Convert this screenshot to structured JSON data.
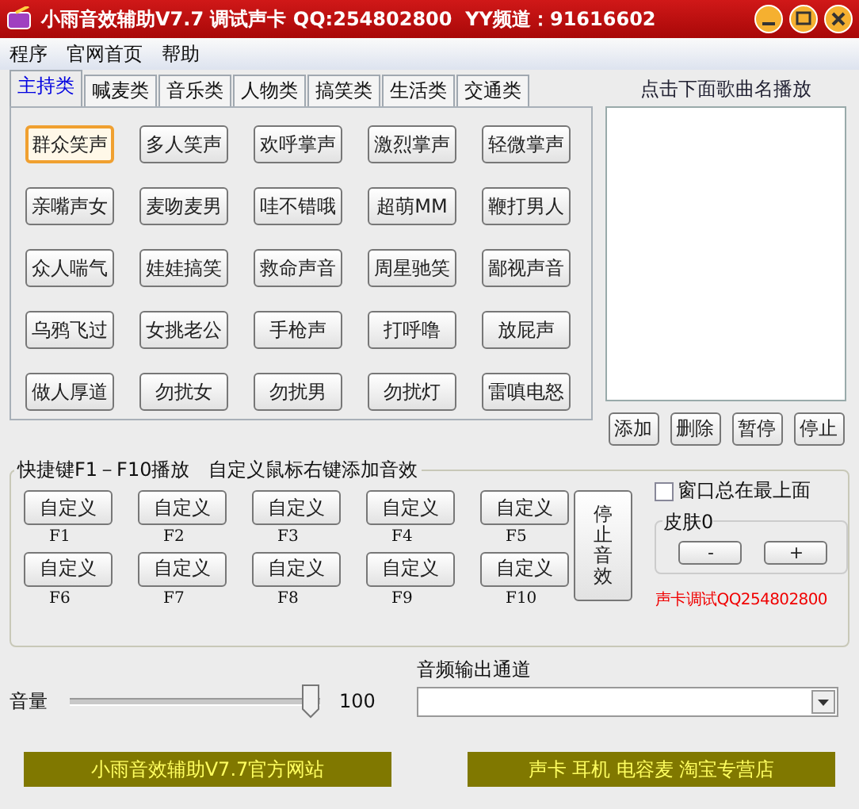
{
  "window": {
    "title": "小雨音效辅助V7.7 调试声卡 QQ:254802800  YY频道：91616602"
  },
  "menu": [
    "程序",
    "官网首页",
    "帮助"
  ],
  "tabs": [
    {
      "label": "主持类",
      "selected": true
    },
    {
      "label": "喊麦类",
      "selected": false
    },
    {
      "label": "音乐类",
      "selected": false
    },
    {
      "label": "人物类",
      "selected": false
    },
    {
      "label": "搞笑类",
      "selected": false
    },
    {
      "label": "生活类",
      "selected": false
    },
    {
      "label": "交通类",
      "selected": false
    }
  ],
  "sound_buttons": [
    {
      "label": "群众笑声",
      "selected": true
    },
    {
      "label": "多人笑声",
      "selected": false
    },
    {
      "label": "欢呼掌声",
      "selected": false
    },
    {
      "label": "激烈掌声",
      "selected": false
    },
    {
      "label": "轻微掌声",
      "selected": false
    },
    {
      "label": "亲嘴声女",
      "selected": false
    },
    {
      "label": "麦吻麦男",
      "selected": false
    },
    {
      "label": "哇不错哦",
      "selected": false
    },
    {
      "label": "超萌MM",
      "selected": false
    },
    {
      "label": "鞭打男人",
      "selected": false
    },
    {
      "label": "众人喘气",
      "selected": false
    },
    {
      "label": "娃娃搞笑",
      "selected": false
    },
    {
      "label": "救命声音",
      "selected": false
    },
    {
      "label": "周星驰笑",
      "selected": false
    },
    {
      "label": "鄙视声音",
      "selected": false
    },
    {
      "label": "乌鸦飞过",
      "selected": false
    },
    {
      "label": "女挑老公",
      "selected": false
    },
    {
      "label": "手枪声",
      "selected": false
    },
    {
      "label": "打呼噜",
      "selected": false
    },
    {
      "label": "放屁声",
      "selected": false
    },
    {
      "label": "做人厚道",
      "selected": false
    },
    {
      "label": "勿扰女",
      "selected": false
    },
    {
      "label": "勿扰男",
      "selected": false
    },
    {
      "label": "勿扰灯",
      "selected": false
    },
    {
      "label": "雷嗔电怒",
      "selected": false
    }
  ],
  "playlist": {
    "label": "点击下面歌曲名播放",
    "buttons": [
      "添加",
      "删除",
      "暂停",
      "停止"
    ]
  },
  "hotkeys": {
    "title": "快捷键F1－F10播放　自定义鼠标右键添加音效",
    "buttons": [
      {
        "label": "自定义",
        "key": "F1"
      },
      {
        "label": "自定义",
        "key": "F2"
      },
      {
        "label": "自定义",
        "key": "F3"
      },
      {
        "label": "自定义",
        "key": "F4"
      },
      {
        "label": "自定义",
        "key": "F5"
      },
      {
        "label": "自定义",
        "key": "F6"
      },
      {
        "label": "自定义",
        "key": "F7"
      },
      {
        "label": "自定义",
        "key": "F8"
      },
      {
        "label": "自定义",
        "key": "F9"
      },
      {
        "label": "自定义",
        "key": "F10"
      }
    ],
    "stop_button": "停止音效",
    "always_on_top": {
      "label": "窗口总在最上面",
      "checked": false
    },
    "skin": {
      "label": "皮肤0",
      "buttons": [
        "-",
        "+"
      ]
    },
    "promo": "声卡调试QQ254802800"
  },
  "volume": {
    "label": "音量",
    "level": 1,
    "reading": "100"
  },
  "output_channel": {
    "label": "音频输出通道"
  },
  "links": [
    "小雨音效辅助V7.7官方网站",
    "声卡 耳机 电容麦 淘宝专营店"
  ]
}
